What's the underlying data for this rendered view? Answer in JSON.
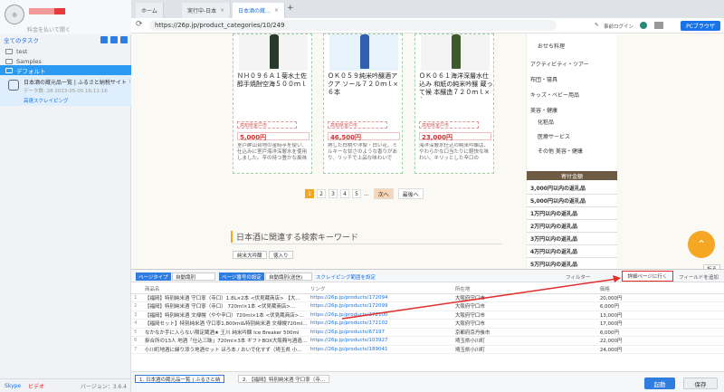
{
  "sidebar": {
    "plan": "料金を払いて開く",
    "tree_header": "全てのタスク",
    "folders": [
      "test",
      "Samples",
      "デフォルト"
    ],
    "task": {
      "title": "日本酒の蔵元品一覧 | ふるさと納税サイト「…",
      "meta": "データ数: 28     2023-05-05 16:11:16",
      "status": "高速スクレイピング"
    },
    "footer": {
      "skype": "Skype",
      "video": "ビデオ",
      "version": "バージョン：3.6.4"
    }
  },
  "tabs": [
    {
      "label": "ホーム"
    },
    {
      "label": "実行中-日本"
    },
    {
      "label": "日本酒の蔵…"
    }
  ],
  "address": {
    "url": "https://26p.jp/product_categories/10/249",
    "login": "事前ログイン",
    "browser": "PCブラウザ"
  },
  "products": [
    {
      "name": "ＮＨ０９６Ａ１菊水土佐 醇手焼酎空海５００ｍｌ",
      "label": "高知県室戸市",
      "price": "5,000円",
      "desc": "室戸岬山台地の金時芋を使い、仕込みに室戸海洋深層水を使用しました。芋の持つ豊かな風味を引き出"
    },
    {
      "name": "ＯＫ０５９純米吟醸酒アクア ソール７２０ｍｌ×６本",
      "label": "高知県室戸市",
      "price": "46,500円",
      "desc": "熟した白桃や洋梨・白い花、ミルキーな甘さのような香りがあり、リッチで上品な味わいです。"
    },
    {
      "name": "ＯＫ０６１海洋深層水仕込み 和紙の純米吟醸 蔵って候 本醸造７２０ｍｌ×各…",
      "label": "高知県室戸市",
      "price": "23,000円",
      "desc": "海洋深層水仕込の純米吟醸は、やわらかな口当たりに軽快な味わい。キリッとした辛口の"
    }
  ],
  "pager": {
    "pages": [
      "1",
      "2",
      "3",
      "4",
      "5"
    ],
    "dots": "...",
    "next": "次へ",
    "last": "最後へ"
  },
  "keywords": {
    "title": "日本酒に関連する検索キーワード",
    "tags": [
      "純米大吟醸",
      "徳入り"
    ]
  },
  "right_menu": [
    "おせち料理",
    "アクティビティ・ツアー",
    "布団・寝具",
    "キッズ・ベビー用品",
    "美容・健康",
    "化粧品",
    "医療サービス",
    "その他 美容・健康"
  ],
  "price_ranking": {
    "title": "寄付金額",
    "items": [
      "3,000円以内の返礼品",
      "5,000円以内の返礼品",
      "1万円以内の返礼品",
      "2万円以内の返礼品",
      "3万円以内の返礼品",
      "4万円以内の返礼品",
      "5万円以内の返礼品"
    ]
  },
  "fab": {
    "icon": "up-arrow-icon",
    "fold": "折る"
  },
  "data_panel": {
    "page_type": "ページタイプ",
    "page_type_value": "自動識別",
    "page_num": "ページ番号の設定",
    "page_num_value": "自動識別(送信)",
    "scrape_link": "スクレイピング範囲を設定",
    "filter": "フィルター",
    "detail": "詳細ページに行く",
    "add_field": "フィールドを追加",
    "columns": [
      "",
      "商品名",
      "リンク",
      "所在地",
      "価格"
    ],
    "rows": [
      [
        "1",
        "【福岡】特別純米酒 守口寧（寺口）1.8L×2本 <伏見蔵商店> 【大…",
        "https://26p.jp/products/172094",
        "大阪府守口市",
        "20,000円"
      ],
      [
        "2",
        "【福岡】特別純米酒 守口寧（寺口） 720ml×1本 <伏見蔵商店>…",
        "https://26p.jp/products/172099",
        "大阪府守口市",
        "6,000円"
      ],
      [
        "3",
        "【福岡】特別純米酒 文禄幌（やや辛口）720ml×1本 <伏見蔵商店>…",
        "https://26p.jp/products/172100",
        "大阪府守口市",
        "13,000円"
      ],
      [
        "4",
        "【福岡セット】特別純米酒 守口寧1,800ml&特別純米酒 文禄幌720ml…",
        "https://26p.jp/products/172102",
        "大阪府守口市",
        "17,000円"
      ],
      [
        "5",
        "なかなか手に入らない限定蔵酒★ 王川 純米吟醸 Ice Breaker 500ml",
        "https://26p.jp/products/67197",
        "京都府京丹後市",
        "6,000円"
      ],
      [
        "6",
        "掛合所の13人 地酒「仕込三昧」720ml×3本 ギフトBOX大阪麹与酒造…",
        "https://26p.jp/products/103927",
        "埼玉県小川町",
        "22,000円"
      ],
      [
        "7",
        "小川町地酒に縁り添う地酒セット ほろ本 / おいで化すず（埼玉県 小…",
        "https://26p.jp/products/189041",
        "埼玉県小川町",
        "24,000円"
      ]
    ]
  },
  "bottom": {
    "tabs": [
      "1. 日本酒の蔵元品一覧 | ふるさと納",
      "2. 【福岡】特別純米酒 守口寧（寺…"
    ],
    "run": "起動",
    "save": "保存"
  },
  "colors": {
    "accent": "#2f7de1",
    "orange": "#f5a623",
    "price_red": "#d03030",
    "annotation_red": "#e03030"
  }
}
